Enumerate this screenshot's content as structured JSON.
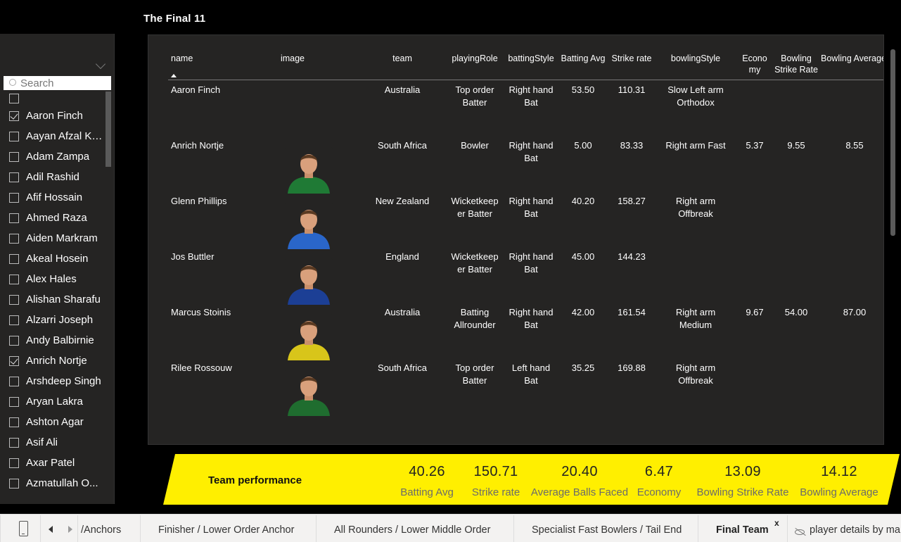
{
  "page": {
    "title": "The Final 11"
  },
  "slicer": {
    "search_placeholder": "Search",
    "items": [
      {
        "label": "",
        "checked": false
      },
      {
        "label": "Aaron Finch",
        "checked": true
      },
      {
        "label": "Aayan Afzal Kh...",
        "checked": false
      },
      {
        "label": "Adam Zampa",
        "checked": false
      },
      {
        "label": "Adil Rashid",
        "checked": false
      },
      {
        "label": "Afif Hossain",
        "checked": false
      },
      {
        "label": "Ahmed Raza",
        "checked": false
      },
      {
        "label": "Aiden Markram",
        "checked": false
      },
      {
        "label": "Akeal Hosein",
        "checked": false
      },
      {
        "label": "Alex Hales",
        "checked": false
      },
      {
        "label": "Alishan Sharafu",
        "checked": false
      },
      {
        "label": "Alzarri Joseph",
        "checked": false
      },
      {
        "label": "Andy Balbirnie",
        "checked": false
      },
      {
        "label": "Anrich Nortje",
        "checked": true
      },
      {
        "label": "Arshdeep Singh",
        "checked": false
      },
      {
        "label": "Aryan Lakra",
        "checked": false
      },
      {
        "label": "Ashton Agar",
        "checked": false
      },
      {
        "label": "Asif Ali",
        "checked": false
      },
      {
        "label": "Axar Patel",
        "checked": false
      },
      {
        "label": "Azmatullah O...",
        "checked": false
      }
    ]
  },
  "table": {
    "columns": {
      "name": "name",
      "image": "image",
      "team": "team",
      "playingRole": "playingRole",
      "battingStyle": "battingStyle",
      "battingAvg": "Batting Avg",
      "strikeRate": "Strike rate",
      "bowlingStyle": "bowlingStyle",
      "economy_1": "Econo",
      "economy_2": "my",
      "bowlingSR_1": "Bowling",
      "bowlingSR_2": "Strike Rate",
      "bowlingAvg": "Bowling Average"
    },
    "rows": [
      {
        "name": "Aaron Finch",
        "team": "Australia",
        "role_1": "Top order",
        "role_2": "Batter",
        "bat_1": "Right hand",
        "bat_2": "Bat",
        "avg": "53.50",
        "sr": "110.31",
        "bowl_1": "Slow Left arm",
        "bowl_2": "Orthodox",
        "econ": "",
        "bsr": "",
        "bavg": "",
        "kit_color": ""
      },
      {
        "name": "Anrich Nortje",
        "team": "South Africa",
        "role_1": "Bowler",
        "role_2": "",
        "bat_1": "Right hand",
        "bat_2": "Bat",
        "avg": "5.00",
        "sr": "83.33",
        "bowl_1": "Right arm Fast",
        "bowl_2": "",
        "econ": "5.37",
        "bsr": "9.55",
        "bavg": "8.55",
        "kit_color": "#1f7a35"
      },
      {
        "name": "Glenn Phillips",
        "team": "New Zealand",
        "role_1": "Wicketkeep",
        "role_2": "er Batter",
        "bat_1": "Right hand",
        "bat_2": "Bat",
        "avg": "40.20",
        "sr": "158.27",
        "bowl_1": "Right arm",
        "bowl_2": "Offbreak",
        "econ": "",
        "bsr": "",
        "bavg": "",
        "kit_color": "#2a66c9"
      },
      {
        "name": "Jos Buttler",
        "team": "England",
        "role_1": "Wicketkeep",
        "role_2": "er Batter",
        "bat_1": "Right hand",
        "bat_2": "Bat",
        "avg": "45.00",
        "sr": "144.23",
        "bowl_1": "",
        "bowl_2": "",
        "econ": "",
        "bsr": "",
        "bavg": "",
        "kit_color": "#1c3f95"
      },
      {
        "name": "Marcus Stoinis",
        "team": "Australia",
        "role_1": "Batting",
        "role_2": "Allrounder",
        "bat_1": "Right hand",
        "bat_2": "Bat",
        "avg": "42.00",
        "sr": "161.54",
        "bowl_1": "Right arm",
        "bowl_2": "Medium",
        "econ": "9.67",
        "bsr": "54.00",
        "bavg": "87.00",
        "kit_color": "#d8c51a"
      },
      {
        "name": "Rilee Rossouw",
        "team": "South Africa",
        "role_1": "Top order",
        "role_2": "Batter",
        "bat_1": "Left hand",
        "bat_2": "Bat",
        "avg": "35.25",
        "sr": "169.88",
        "bowl_1": "Right arm",
        "bowl_2": "Offbreak",
        "econ": "",
        "bsr": "",
        "bavg": "",
        "kit_color": "#1f6d2f"
      }
    ]
  },
  "team_performance": {
    "title": "Team performance",
    "kpis": [
      {
        "value": "40.26",
        "label": "Batting Avg"
      },
      {
        "value": "150.71",
        "label": "Strike rate"
      },
      {
        "value": "20.40",
        "label": "Average Balls Faced"
      },
      {
        "value": "6.47",
        "label": "Economy"
      },
      {
        "value": "13.09",
        "label": "Bowling Strike Rate"
      },
      {
        "value": "14.12",
        "label": "Bowling Average"
      }
    ],
    "banner_color": "#ffef00"
  },
  "tabs": {
    "items": [
      "/Anchors",
      "Finisher / Lower Order Anchor",
      "All Rounders / Lower Middle Order",
      "Specialist Fast Bowlers / Tail End",
      "Final Team",
      "player details by ma"
    ],
    "close": "x",
    "active": "Final Team"
  }
}
